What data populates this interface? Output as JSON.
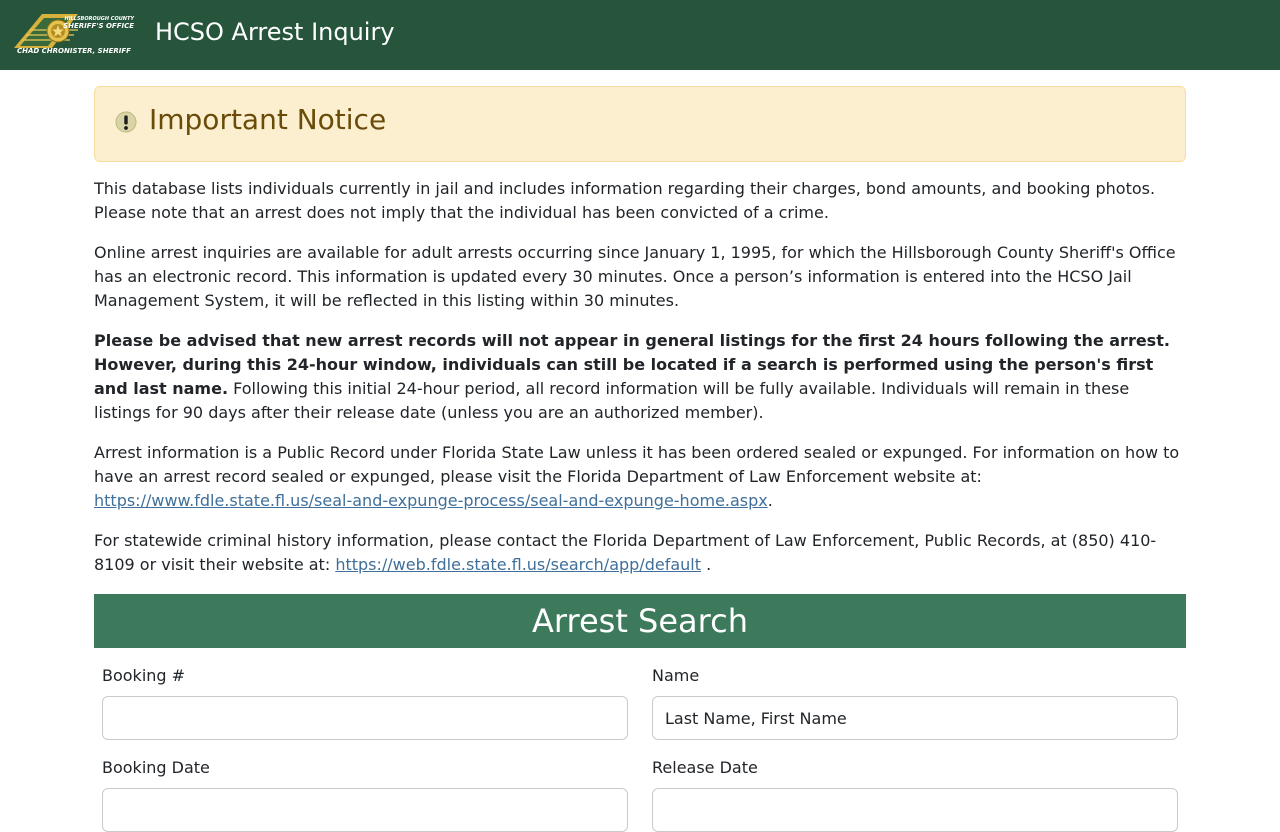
{
  "header": {
    "title": "HCSO Arrest Inquiry",
    "logo": {
      "line1": "HILLSBOROUGH COUNTY",
      "line2": "SHERIFF'S OFFICE",
      "line3": "CHAD CHRONISTER, SHERIFF"
    }
  },
  "notice": {
    "icon": "exclamation-circle-icon",
    "title": "Important Notice"
  },
  "paragraphs": {
    "p1": "This database lists individuals currently in jail and includes information regarding their charges, bond amounts, and booking photos. Please note that an arrest does not imply that the individual has been convicted of a crime.",
    "p2": "Online arrest inquiries are available for adult arrests occurring since January 1, 1995, for which the Hillsborough County Sheriff's Office has an electronic record. This information is updated every 30 minutes. Once a person’s information is entered into the HCSO Jail Management System, it will be reflected in this listing within 30 minutes.",
    "p3_bold": "Please be advised that new arrest records will not appear in general listings for the first 24 hours following the arrest. However, during this 24-hour window, individuals can still be located if a search is performed using the person's first and last name.",
    "p3_rest": " Following this initial 24-hour period, all record information will be fully available. Individuals will remain in these listings for 90 days after their release date (unless you are an authorized member).",
    "p4_text": "Arrest information is a Public Record under Florida State Law unless it has been ordered sealed or expunged. For information on how to have an arrest record sealed or expunged, please visit the Florida Department of Law Enforcement website at: ",
    "p4_link": "https://www.fdle.state.fl.us/seal-and-expunge-process/seal-and-expunge-home.aspx",
    "p4_end": ".",
    "p5_text": "For statewide criminal history information, please contact the Florida Department of Law Enforcement, Public Records, at (850) 410-8109 or visit their website at: ",
    "p5_link": "https://web.fdle.state.fl.us/search/app/default",
    "p5_end": " ."
  },
  "search": {
    "title": "Arrest Search",
    "booking_label": "Booking #",
    "booking_value": "",
    "name_label": "Name",
    "name_placeholder": "Last Name, First Name",
    "booking_date_label": "Booking Date",
    "release_date_label": "Release Date"
  },
  "colors": {
    "topbar": "#27553c",
    "search_header": "#3c7a5b",
    "notice_bg": "#fcefcf",
    "notice_text": "#694c0a",
    "link": "#3f6f9a"
  }
}
